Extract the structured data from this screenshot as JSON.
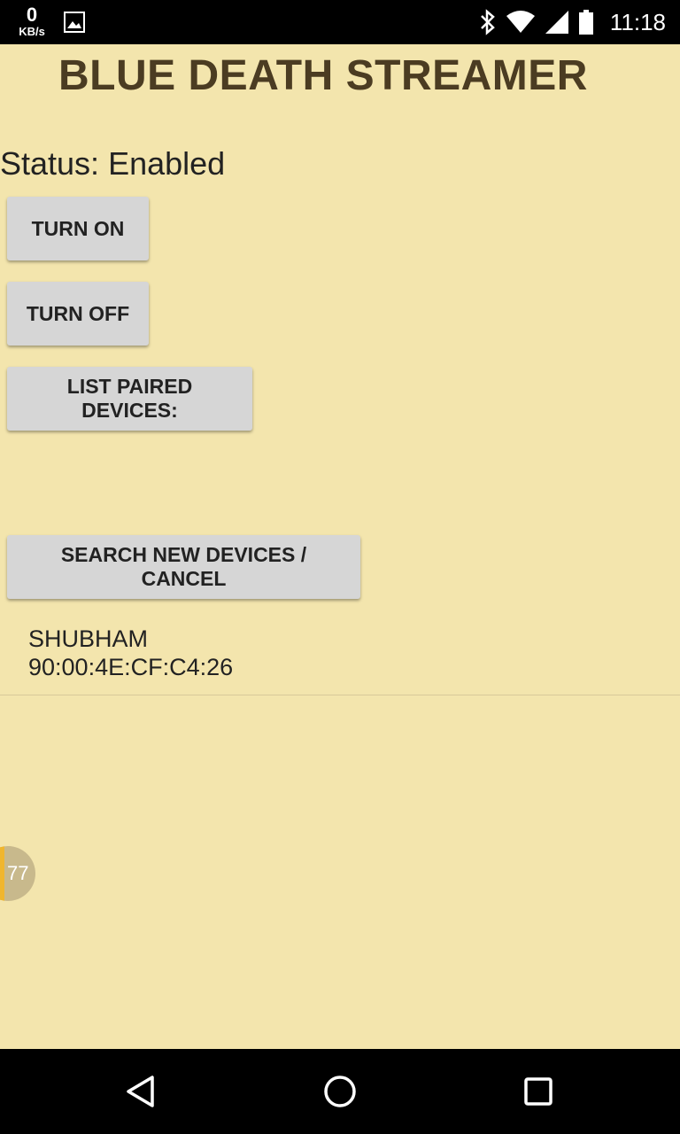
{
  "status_bar": {
    "net_speed_value": "0",
    "net_speed_unit": "KB/s",
    "time": "11:18",
    "icons": [
      "image-icon",
      "bluetooth-icon",
      "wifi-icon",
      "signal-icon",
      "battery-icon"
    ]
  },
  "app": {
    "title": "BLUE DEATH STREAMER",
    "status": "Status: Enabled",
    "buttons": {
      "turn_on": "TURN ON",
      "turn_off": "TURN OFF",
      "list_paired": "LIST PAIRED DEVICES:",
      "search": "SEARCH NEW DEVICES / CANCEL"
    },
    "devices": [
      {
        "name": "SHUBHAM",
        "mac": "90:00:4E:CF:C4:26"
      }
    ],
    "floating_badge": "77"
  },
  "nav_bar": {
    "icons": [
      "back-icon",
      "home-icon",
      "recents-icon"
    ]
  },
  "colors": {
    "background": "#f3e5ad",
    "title": "#4b3c22",
    "button": "#d6d6d6",
    "badge_accent": "#f0b62e"
  }
}
